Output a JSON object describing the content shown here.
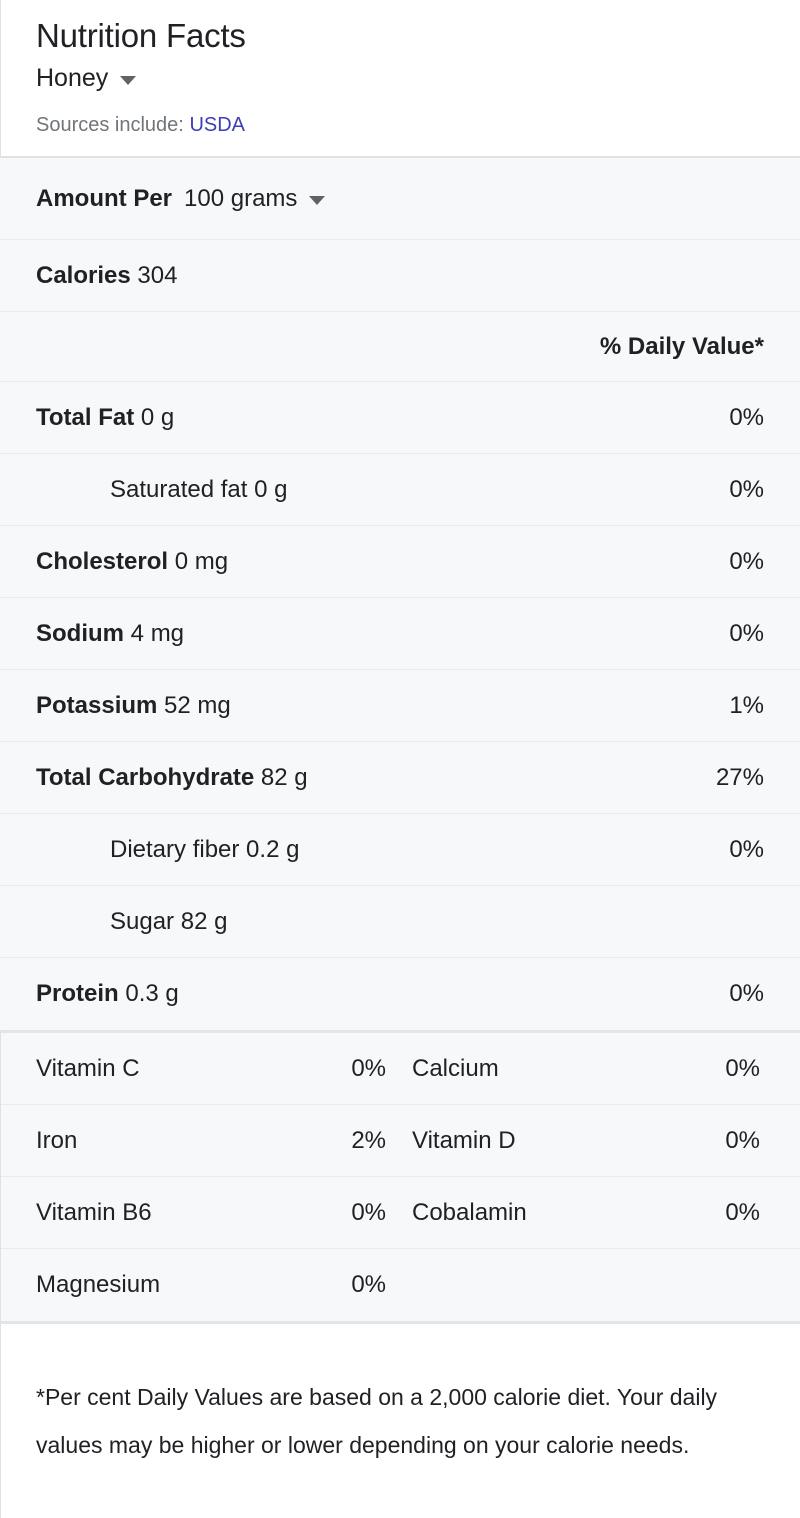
{
  "header": {
    "title": "Nutrition Facts",
    "subject": "Honey",
    "subject_caret_icon": "chevron-down-icon",
    "sources_label": "Sources include:",
    "source_link": "USDA"
  },
  "serving": {
    "amount_label": "Amount Per",
    "amount_value": "100 grams",
    "amount_caret_icon": "chevron-down-icon",
    "calories_label": "Calories",
    "calories_value": "304",
    "daily_value_header": "% Daily Value*"
  },
  "nutrients": [
    {
      "name": "Total Fat",
      "amount": "0 g",
      "dv": "0%",
      "bold": true,
      "indent": false
    },
    {
      "name": "Saturated fat",
      "amount": "0 g",
      "dv": "0%",
      "bold": false,
      "indent": true
    },
    {
      "name": "Cholesterol",
      "amount": "0 mg",
      "dv": "0%",
      "bold": true,
      "indent": false
    },
    {
      "name": "Sodium",
      "amount": "4 mg",
      "dv": "0%",
      "bold": true,
      "indent": false
    },
    {
      "name": "Potassium",
      "amount": "52 mg",
      "dv": "1%",
      "bold": true,
      "indent": false
    },
    {
      "name": "Total Carbohydrate",
      "amount": "82 g",
      "dv": "27%",
      "bold": true,
      "indent": false
    },
    {
      "name": "Dietary fiber",
      "amount": "0.2 g",
      "dv": "0%",
      "bold": false,
      "indent": true
    },
    {
      "name": "Sugar",
      "amount": "82 g",
      "dv": "",
      "bold": false,
      "indent": true
    },
    {
      "name": "Protein",
      "amount": "0.3 g",
      "dv": "0%",
      "bold": true,
      "indent": false
    }
  ],
  "vitamins": [
    {
      "left_name": "Vitamin C",
      "left_dv": "0%",
      "right_name": "Calcium",
      "right_dv": "0%"
    },
    {
      "left_name": "Iron",
      "left_dv": "2%",
      "right_name": "Vitamin D",
      "right_dv": "0%"
    },
    {
      "left_name": "Vitamin B6",
      "left_dv": "0%",
      "right_name": "Cobalamin",
      "right_dv": "0%"
    },
    {
      "left_name": "Magnesium",
      "left_dv": "0%",
      "right_name": "",
      "right_dv": ""
    }
  ],
  "footnote": "*Per cent Daily Values are based on a 2,000 calorie diet. Your daily values may be higher or lower depending on your calorie needs.",
  "colors": {
    "link": "#3d3db8",
    "row_background": "#f7f8fa",
    "text": "#202124",
    "muted_text": "#70757a",
    "divider": "#e8eaed"
  }
}
